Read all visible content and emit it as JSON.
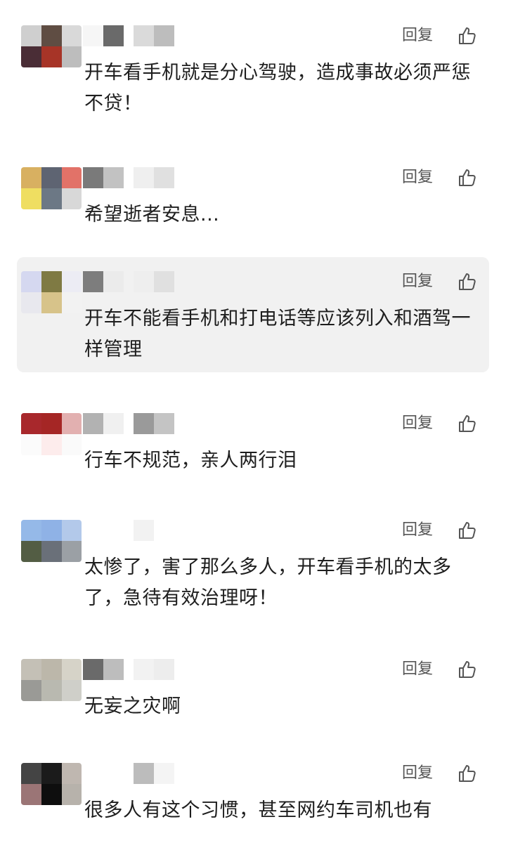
{
  "labels": {
    "reply": "回复"
  },
  "colors": {
    "highlight_bg": "#f1f1f1",
    "reply_text": "#555555",
    "comment_text": "#1e1e1e"
  },
  "comments": [
    {
      "text": "开车看手机就是分心驾驶，造成事故必须严惩不贷！",
      "highlighted": false,
      "avatar_colors": [
        "#cfcfcf",
        "#5f4d43",
        "#d9d9d9",
        "#4a2d36",
        "#a73427",
        "#bdbdbd"
      ],
      "nick_colors": [
        "#f6f6f6",
        "#6a6a6a",
        "#dadada",
        "#bdbdbd"
      ]
    },
    {
      "text": "希望逝者安息...",
      "highlighted": false,
      "avatar_colors": [
        "#d8b061",
        "#5e6472",
        "#e27268",
        "#efde61",
        "#6c7885",
        "#d8d8d8"
      ],
      "nick_colors": [
        "#7a7a7a",
        "#c2c2c2",
        "#efefef",
        "#e0e0e0"
      ]
    },
    {
      "text": "开车不能看手机和打电话等应该列入和酒驾一样管理",
      "highlighted": true,
      "avatar_colors": [
        "#d5d8f0",
        "#7f7a43",
        "#ececf4",
        "#e8e8ee",
        "#d7c38a",
        "#f2f2f2"
      ],
      "nick_colors": [
        "#7d7d7d",
        "#ebebeb",
        "#eeeeee",
        "#e0e0e0"
      ]
    },
    {
      "text": "行车不规范，亲人两行泪",
      "highlighted": false,
      "avatar_colors": [
        "#a8282c",
        "#a52625",
        "#e2b0b0",
        "#fbfbfb",
        "#fdecec",
        "#fafafa"
      ],
      "nick_colors": [
        "#b2b2b2",
        "#f0f0f0",
        "#9a9a9a",
        "#c4c4c4"
      ]
    },
    {
      "text": "太惨了，害了那么多人，开车看手机的太多了，急待有效治理呀！",
      "highlighted": false,
      "avatar_colors": [
        "#95b9e8",
        "#8fb2e6",
        "#b3c9ea",
        "#535d44",
        "#6a7079",
        "#9ba0a5"
      ],
      "nick_colors": [
        "#ffffff",
        "#ffffff",
        "#f2f2f2",
        "#ffffff"
      ]
    },
    {
      "text": "无妄之灾啊",
      "highlighted": false,
      "avatar_colors": [
        "#c4c0b6",
        "#bcb7aa",
        "#d6d3c8",
        "#9a9a96",
        "#b9b9b0",
        "#cfcfc9"
      ],
      "nick_colors": [
        "#6a6a6a",
        "#bdbdbd",
        "#f2f2f2",
        "#ededed"
      ]
    },
    {
      "text": "很多人有这个习惯，甚至网约车司机也有",
      "highlighted": false,
      "avatar_colors": [
        "#444444",
        "#1b1b1b",
        "#bfb7b0",
        "#9b7576",
        "#0e0e0e",
        "#b7b2ab"
      ],
      "nick_colors": [
        "#ffffff",
        "#ffffff",
        "#bcbcbc",
        "#f4f4f4"
      ]
    }
  ]
}
